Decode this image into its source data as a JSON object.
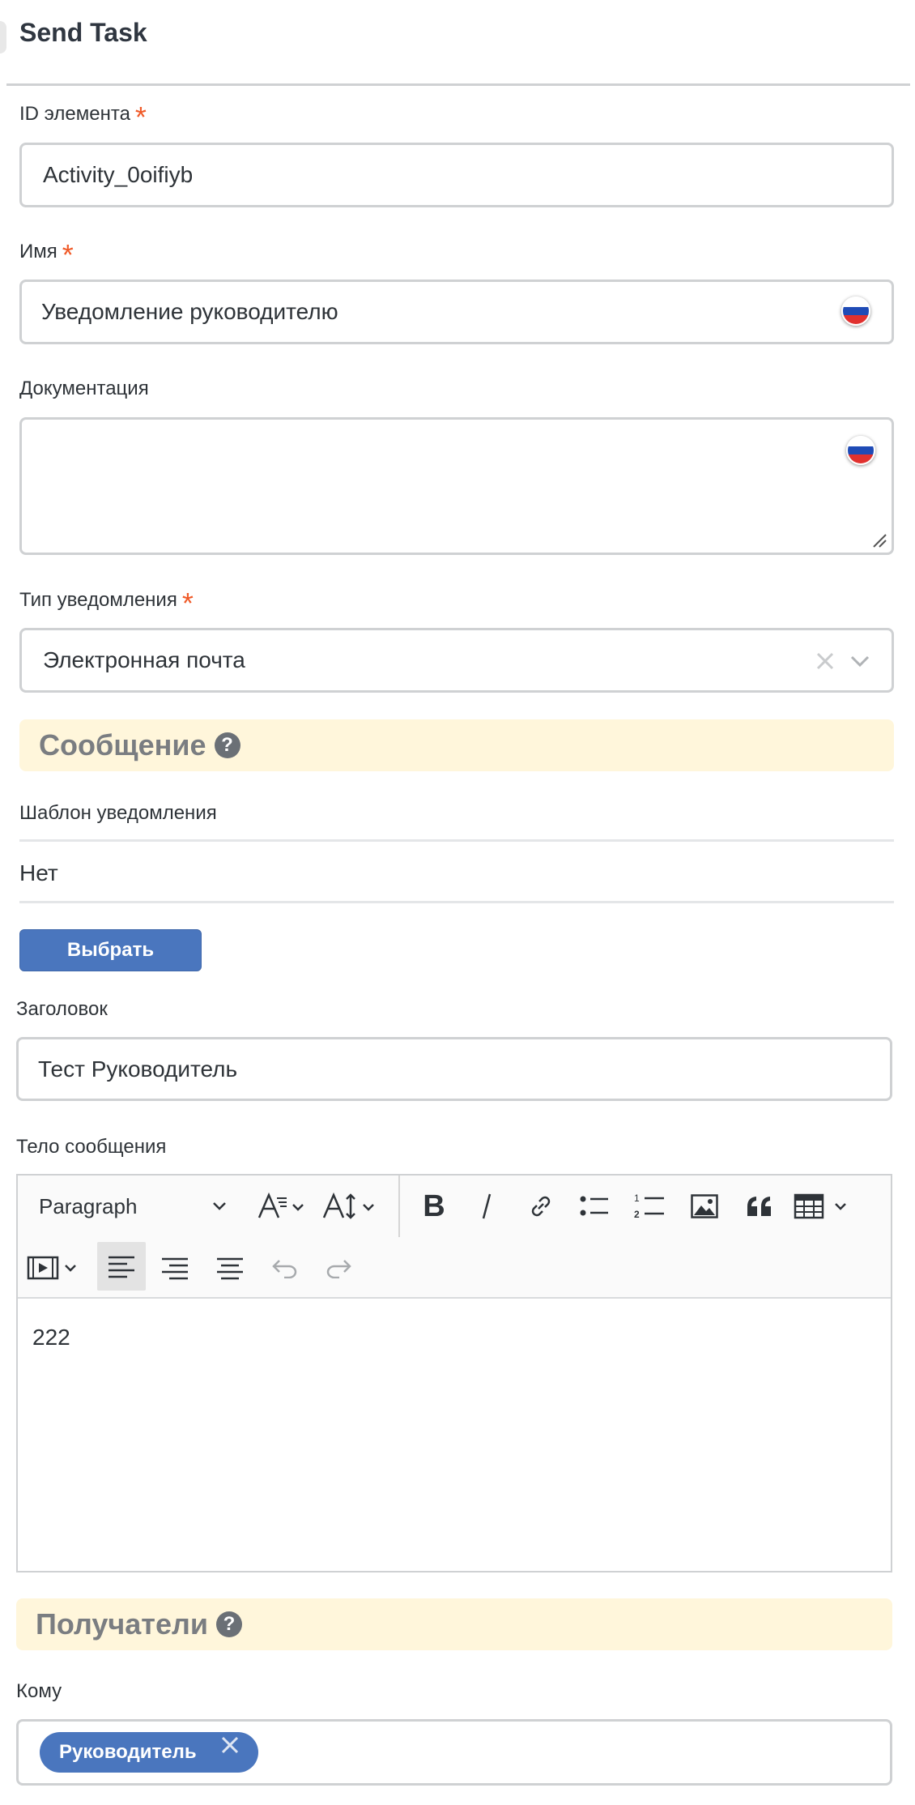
{
  "header": {
    "title": "Send Task"
  },
  "fields": {
    "element_id": {
      "label": "ID элемента",
      "required_mark": "*",
      "value": "Activity_0oifiyb"
    },
    "name": {
      "label": "Имя",
      "required_mark": "*",
      "value": "Уведомление руководителю"
    },
    "documentation": {
      "label": "Документация",
      "value": ""
    },
    "notification_type": {
      "label": "Тип уведомления",
      "required_mark": "*",
      "value": "Электронная почта"
    }
  },
  "message_section": {
    "title": "Сообщение",
    "template_label": "Шаблон уведомления",
    "template_value": "Нет",
    "choose_button": "Выбрать",
    "subject_label": "Заголовок",
    "subject_value": "Тест Руководитель",
    "body_label": "Тело сообщения",
    "body_value": "222",
    "toolbar": {
      "paragraph_select": "Paragraph"
    }
  },
  "recipients_section": {
    "title": "Получатели",
    "to_label": "Кому",
    "chips": [
      "Руководитель"
    ]
  },
  "colors": {
    "accent": "#4a76be",
    "required": "#f05a28",
    "section_bg": "#fff6db"
  }
}
